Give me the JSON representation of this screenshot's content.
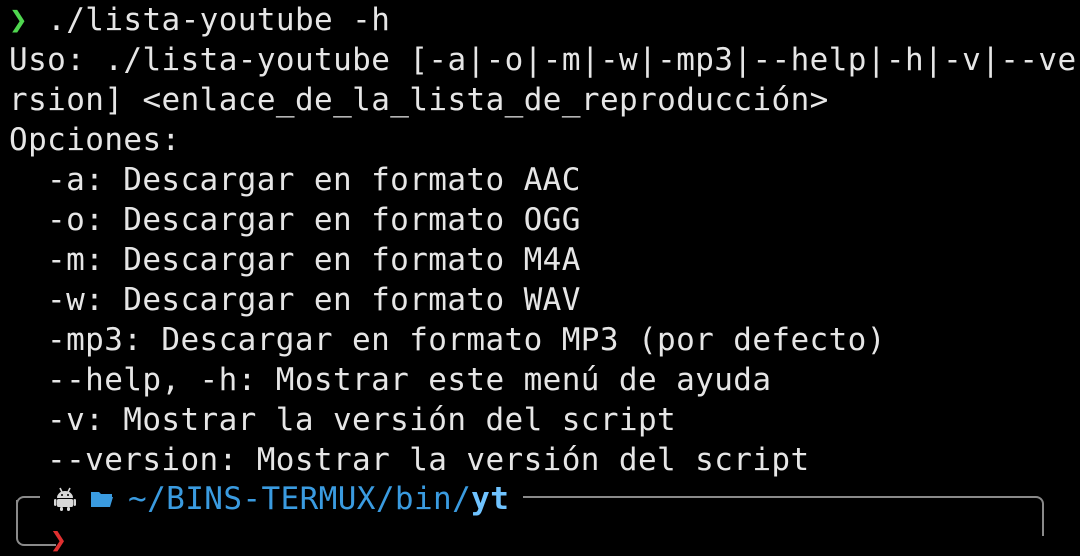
{
  "terminal": {
    "prompt_symbol": "❯",
    "command": " ./lista-youtube -h",
    "usage_line1": "Uso: ./lista-youtube [-a|-o|-m|-w|-mp3|--help|-h|-v|--ve",
    "usage_line2": "rsion] <enlace_de_la_lista_de_reproducción>",
    "options_header": "Opciones:",
    "options": [
      "-a: Descargar en formato AAC",
      "-o: Descargar en formato OGG",
      "-m: Descargar en formato M4A",
      "-w: Descargar en formato WAV",
      "-mp3: Descargar en formato MP3 (por defecto)",
      "--help, -h: Mostrar este menú de ayuda",
      "-v: Mostrar la versión del script",
      "--version: Mostrar la versión del script"
    ]
  },
  "prompt": {
    "path_prefix": "~/BINS-TERMUX/bin/",
    "path_current": "yt",
    "chevron": "❯",
    "icons": [
      "android-icon",
      "folder-icon"
    ]
  },
  "colors": {
    "background": "#000000",
    "text": "#e6e6e6",
    "prompt_green": "#4fd64f",
    "path_blue": "#3a9be0",
    "chevron_red": "#e03030"
  }
}
